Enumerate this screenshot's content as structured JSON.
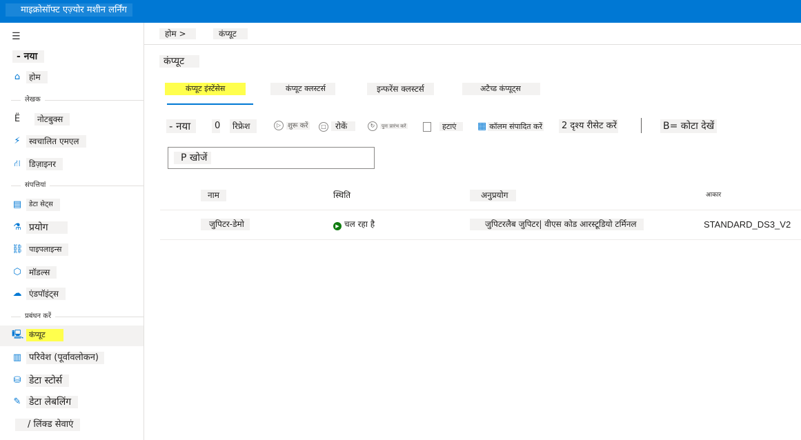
{
  "app": {
    "title": "माइक्रोसॉफ्ट एज़्योर मशीन लर्निंग"
  },
  "sidebar": {
    "new_label": "- नया",
    "home": "होम",
    "sections": {
      "author": "लेखक",
      "assets": "संपत्तियां",
      "manage": "प्रबंधन करें"
    },
    "author_items": [
      {
        "label": "नोटबुक्स",
        "icon": "notebook-icon"
      },
      {
        "label": "स्वचालित एमएल",
        "icon": "automl-icon"
      },
      {
        "label": "डिज़ाइनर",
        "icon": "designer-icon"
      }
    ],
    "asset_items": [
      {
        "label": "डेटा सेट्स",
        "icon": "datasets-icon"
      },
      {
        "label": "प्रयोग",
        "icon": "experiments-icon"
      },
      {
        "label": "पाइपलाइन्स",
        "icon": "pipelines-icon"
      },
      {
        "label": "मॉडल्स",
        "icon": "models-icon"
      },
      {
        "label": "एंडपॉइंट्स",
        "icon": "endpoints-icon"
      }
    ],
    "manage_items": [
      {
        "label": "कंप्यूट",
        "icon": "compute-icon"
      },
      {
        "label": "परिवेश (पूर्वावलोकन)",
        "icon": "environments-icon"
      },
      {
        "label": "डेटा स्टोर्स",
        "icon": "datastores-icon"
      },
      {
        "label": "डेटा लेबलिंग",
        "icon": "data-labeling-icon"
      },
      {
        "label": "/ लिंक्ड सेवाएं",
        "icon": "linked-services-icon"
      }
    ]
  },
  "breadcrumb": {
    "home": "होम >",
    "current": "कंप्यूट"
  },
  "page": {
    "title": "कंप्यूट"
  },
  "tabs": [
    "कंप्यूट इंस्टेंसेस",
    "कंप्यूट क्लस्टर्स",
    "इन्फरेंस क्लस्टर्स",
    "अटैच्ड कंप्यूट्स"
  ],
  "toolbar": {
    "new": "- नया",
    "refresh_icon": "0",
    "refresh": "रिफ्रेश",
    "start": "शुरू करें",
    "stop": "रोकें",
    "restart": "पुनः प्रारंभ करें",
    "delete": "हटाएं",
    "edit_columns": "कॉलम संपादित करें",
    "reset_view": "2 दृश्य रीसेट करें",
    "quota": "B= कोटा देखें"
  },
  "search": {
    "placeholder": "P खोजें"
  },
  "table": {
    "headers": {
      "name": "नाम",
      "state": "स्थिति",
      "apps": "अनुप्रयोग",
      "size": "आकार"
    },
    "rows": [
      {
        "name": "जुपिटर-डेमो",
        "state": "चल रहा है",
        "apps": "जुपिटरलैब जुपिटर| वीएस कोड आरस्टूडियो टर्मिनल",
        "size": "STANDARD_DS3_V2"
      }
    ]
  },
  "colors": {
    "brand": "#0078d4",
    "highlight": "#ffff4d",
    "running": "#107c10"
  }
}
